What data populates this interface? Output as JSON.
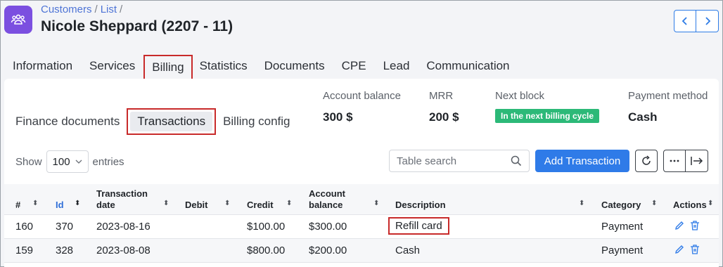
{
  "header": {
    "breadcrumb": [
      "Customers",
      "List"
    ],
    "title": "Nicole Sheppard (2207 - 11)",
    "accent": "#7b4fe0"
  },
  "main_tabs": [
    "Information",
    "Services",
    "Billing",
    "Statistics",
    "Documents",
    "CPE",
    "Lead",
    "Communication"
  ],
  "sub_tabs": [
    "Finance documents",
    "Transactions",
    "Billing config"
  ],
  "stats": {
    "account_balance": {
      "label": "Account balance",
      "value": "300 $"
    },
    "mrr": {
      "label": "MRR",
      "value": "200 $"
    },
    "next_block": {
      "label": "Next block",
      "value": "In the next billing cycle"
    },
    "payment_method": {
      "label": "Payment method",
      "value": "Cash"
    }
  },
  "toolbar": {
    "show_label": "Show",
    "entries_value": "100",
    "entries_label": "entries",
    "search_placeholder": "Table search",
    "add_button": "Add Transaction"
  },
  "table": {
    "columns": [
      "#",
      "Id",
      "Transaction date",
      "Debit",
      "Credit",
      "Account balance",
      "Description",
      "Category",
      "Actions"
    ],
    "rows": [
      {
        "num": "160",
        "id": "370",
        "date": "2023-08-16",
        "debit": "",
        "credit": "$100.00",
        "balance": "$300.00",
        "description": "Refill card",
        "category": "Payment"
      },
      {
        "num": "159",
        "id": "328",
        "date": "2023-08-08",
        "debit": "",
        "credit": "$800.00",
        "balance": "$200.00",
        "description": "Cash",
        "category": "Payment"
      }
    ]
  },
  "colors": {
    "primary": "#2f7be8",
    "badge": "#2cb978",
    "highlight": "#c82a2a"
  },
  "icons": [
    "customers-icon",
    "chevron-left-icon",
    "chevron-right-icon",
    "search-icon",
    "refresh-icon",
    "more-icon",
    "export-icon",
    "edit-icon",
    "trash-icon",
    "sort-icon"
  ]
}
